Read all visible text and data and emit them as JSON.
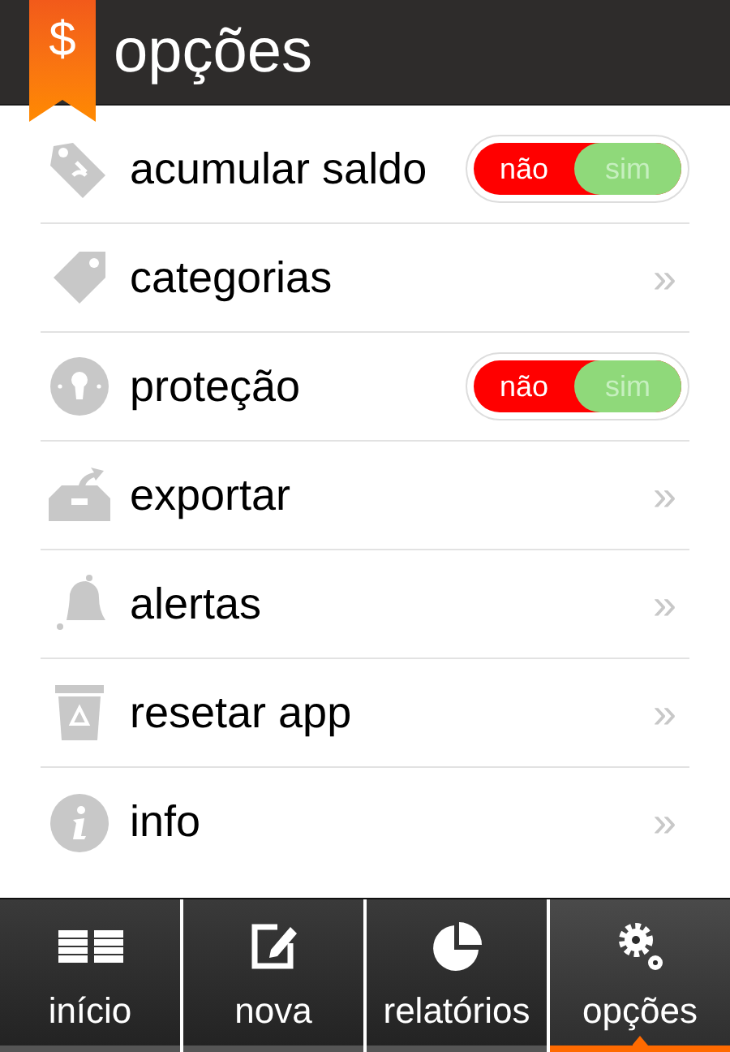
{
  "header": {
    "logo": "$",
    "title": "opções"
  },
  "items": [
    {
      "kind": "toggle",
      "label": "acumular saldo",
      "on": false,
      "off_label": "não",
      "on_label": "sim"
    },
    {
      "kind": "link",
      "label": "categorias",
      "chevron": "»"
    },
    {
      "kind": "toggle",
      "label": "proteção",
      "on": false,
      "off_label": "não",
      "on_label": "sim"
    },
    {
      "kind": "link",
      "label": "exportar",
      "chevron": "»"
    },
    {
      "kind": "link",
      "label": "alertas",
      "chevron": "»"
    },
    {
      "kind": "link",
      "label": "resetar app",
      "chevron": "»"
    },
    {
      "kind": "link",
      "label": "info",
      "chevron": "»"
    }
  ],
  "tabs": [
    {
      "label": "início",
      "selected": false
    },
    {
      "label": "nova",
      "selected": false
    },
    {
      "label": "relatórios",
      "selected": false
    },
    {
      "label": "opções",
      "selected": true
    }
  ]
}
